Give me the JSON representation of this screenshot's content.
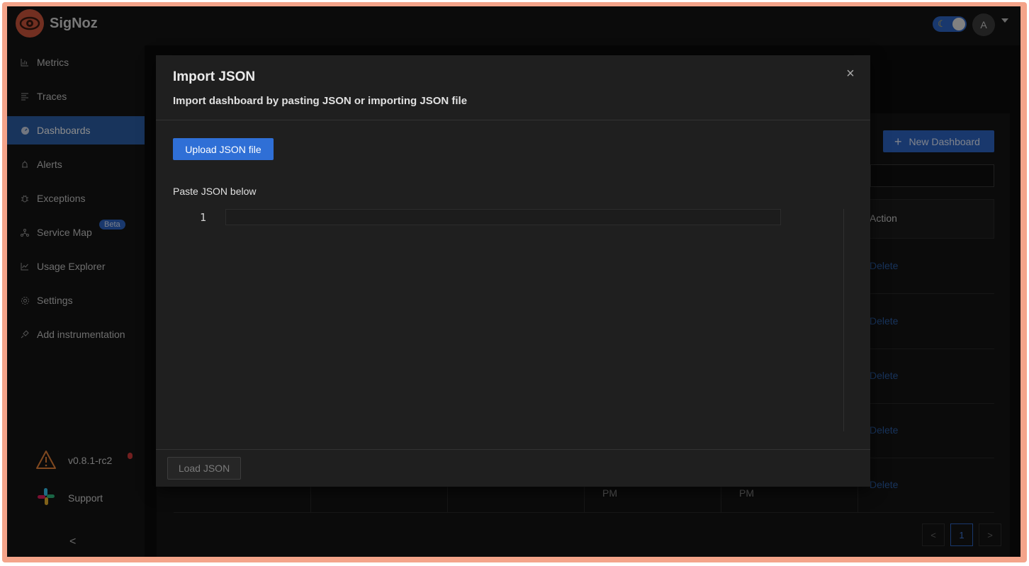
{
  "app": {
    "brand": "SigNoz"
  },
  "header": {
    "avatar_initial": "A"
  },
  "sidebar": {
    "items": [
      {
        "label": "Metrics",
        "icon": "bar-chart-icon"
      },
      {
        "label": "Traces",
        "icon": "align-left-icon"
      },
      {
        "label": "Dashboards",
        "icon": "dashboard-icon",
        "active": true
      },
      {
        "label": "Alerts",
        "icon": "alert-bell-icon"
      },
      {
        "label": "Exceptions",
        "icon": "bug-icon"
      },
      {
        "label": "Service Map",
        "icon": "deployment-unit-icon"
      },
      {
        "label": "Usage Explorer",
        "icon": "line-chart-icon"
      },
      {
        "label": "Settings",
        "icon": "gear-icon"
      },
      {
        "label": "Add instrumentation",
        "icon": "api-icon"
      }
    ],
    "beta_badge": "Beta",
    "version": "v0.8.1-rc2",
    "support": "Support",
    "collapse": "<"
  },
  "page": {
    "new_dashboard": "New Dashboard",
    "action_header": "Action",
    "delete_label": "Delete",
    "pm_label": "PM",
    "pager": {
      "prev": "<",
      "current": "1",
      "next": ">"
    }
  },
  "modal": {
    "title": "Import JSON",
    "subtitle": "Import dashboard by pasting JSON or importing JSON file",
    "upload_label": "Upload JSON file",
    "paste_label": "Paste JSON below",
    "line_number": "1",
    "load_label": "Load JSON",
    "close": "×"
  },
  "colors": {
    "accent": "#2f67c6",
    "sidebar_active": "#2c5fa8",
    "brand": "#d0573c",
    "frame": "#f4a48a",
    "warning": "#e8833a"
  }
}
